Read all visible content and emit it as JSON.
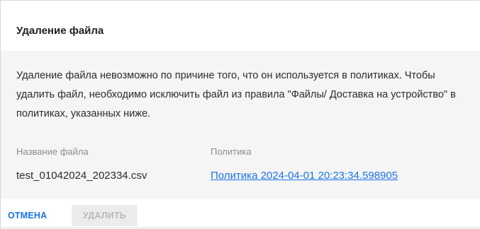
{
  "dialog": {
    "title": "Удаление файла",
    "message": "Удаление файла невозможно по причине того, что он используется в политиках. Чтобы удалить файл, необходимо исключить файл из правила \"Файлы/ Доставка на устройство\" в политиках, указанных ниже.",
    "columns": {
      "file_name_header": "Название файла",
      "policy_header": "Политика"
    },
    "rows": [
      {
        "file_name": "test_01042024_202334.csv",
        "policy": "Политика 2024-04-01 20:23:34.598905"
      }
    ],
    "buttons": {
      "cancel_label": "ОТМЕНА",
      "delete_label": "УДАЛИТЬ",
      "delete_disabled": true
    },
    "colors": {
      "accent": "#1a73e8",
      "body_background": "#f5f5f5",
      "disabled_button": "#ececec"
    }
  }
}
